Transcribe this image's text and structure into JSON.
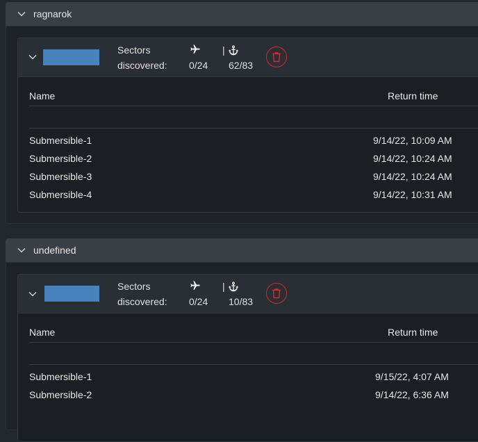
{
  "groups": [
    {
      "title": "ragnarok",
      "card": {
        "sectors_label_1": "Sectors",
        "sectors_label_2": "discovered:",
        "plane_count": "0/24",
        "separator": "|",
        "anchor_count": "62/83",
        "col_name": "Name",
        "col_return": "Return time",
        "rows": [
          {
            "name": "Submersible-1",
            "time": "9/14/22, 10:09 AM"
          },
          {
            "name": "Submersible-2",
            "time": "9/14/22, 10:24 AM"
          },
          {
            "name": "Submersible-3",
            "time": "9/14/22, 10:24 AM"
          },
          {
            "name": "Submersible-4",
            "time": "9/14/22, 10:31 AM"
          }
        ]
      }
    },
    {
      "title": "undefined",
      "card": {
        "sectors_label_1": "Sectors",
        "sectors_label_2": "discovered:",
        "plane_count": "0/24",
        "separator": "|",
        "anchor_count": "10/83",
        "col_name": "Name",
        "col_return": "Return time",
        "rows": [
          {
            "name": "Submersible-1",
            "time": "9/15/22, 4:07 AM"
          },
          {
            "name": "Submersible-2",
            "time": "9/14/22, 6:36 AM"
          }
        ]
      }
    }
  ],
  "colors": {
    "accent_blue": "#4a82be",
    "delete_red": "#d42a2a",
    "header_bg": "#3a3e45",
    "page_bg": "#23272e"
  }
}
